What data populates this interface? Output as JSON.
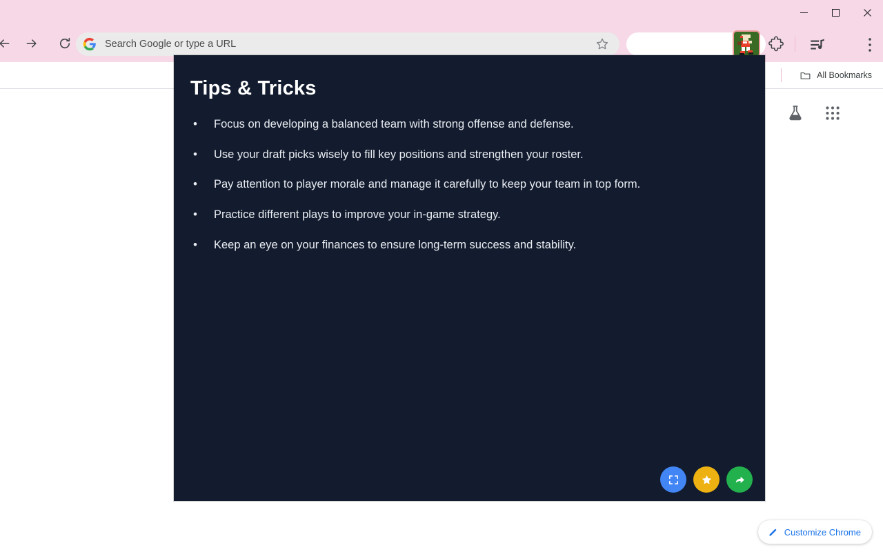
{
  "window": {
    "controls": [
      {
        "name": "minimize",
        "label": "Minimize"
      },
      {
        "name": "maximize",
        "label": "Maximize"
      },
      {
        "name": "close",
        "label": "Close"
      }
    ],
    "titlebar_color": "#f6d8e7"
  },
  "toolbar": {
    "back_label": "Back",
    "forward_label": "Forward",
    "reload_label": "Reload",
    "omnibox": {
      "value": "",
      "placeholder": "Search Google or type a URL",
      "search_engine_icon": "google-g-icon",
      "bookmark_icon": "star-outline-icon"
    },
    "extension_icon_name": "sports-player-extension-icon",
    "extensions_puzzle_label": "Extensions",
    "media_control_label": "Media controls",
    "menu_label": "Customize and control Google Chrome"
  },
  "bookmarks_bar": {
    "all_bookmarks_label": "All Bookmarks",
    "folder_icon": "folder-icon"
  },
  "new_tab_page": {
    "labs_icon": "flask-labs-icon",
    "apps_icon": "apps-grid-icon",
    "customize_button": {
      "label": "Customize Chrome",
      "icon": "pencil-icon",
      "color": "#1a73e8"
    }
  },
  "panel": {
    "background": "#131c2e",
    "title": "Tips & Tricks",
    "tips": [
      "Focus on developing a balanced team with strong offense and defense.",
      "Use your draft picks wisely to fill key positions and strengthen your roster.",
      "Pay attention to player morale and manage it carefully to keep your team in top form.",
      "Practice different plays to improve your in-game strategy.",
      "Keep an eye on your finances to ensure long-term success and stability."
    ],
    "actions": [
      {
        "name": "fullscreen",
        "icon": "fullscreen-icon",
        "color": "#4285f4",
        "label": "Fullscreen"
      },
      {
        "name": "favorite",
        "icon": "star-icon",
        "color": "#edb111",
        "label": "Favorite"
      },
      {
        "name": "share",
        "icon": "share-arrow-icon",
        "color": "#22b14c",
        "label": "Share"
      }
    ]
  }
}
